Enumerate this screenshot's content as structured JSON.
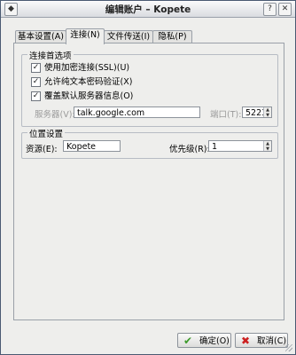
{
  "window": {
    "title": "编辑账户 – Kopete"
  },
  "tabs": [
    {
      "label": "基本设置(A)"
    },
    {
      "label": "连接(N)"
    },
    {
      "label": "文件传送(I)"
    },
    {
      "label": "隐私(P)"
    }
  ],
  "connection": {
    "group_title": "连接首选项",
    "options": [
      {
        "label": "使用加密连接(SSL)(U)",
        "checked": true
      },
      {
        "label": "允许纯文本密码验证(X)",
        "checked": true
      },
      {
        "label": "覆盖默认服务器信息(O)",
        "checked": true
      }
    ],
    "server_label": "服务器(V):",
    "server_value": "talk.google.com",
    "port_label": "端口(T):",
    "port_value": "5223"
  },
  "location": {
    "group_title": "位置设置",
    "resource_label": "资源(E):",
    "resource_value": "Kopete",
    "priority_label": "优先级(R):",
    "priority_value": "1"
  },
  "buttons": {
    "ok": "确定(O)",
    "cancel": "取消(C)"
  },
  "colors": {
    "ok_icon": "#3c9a2a",
    "cancel_icon": "#cc2020"
  }
}
